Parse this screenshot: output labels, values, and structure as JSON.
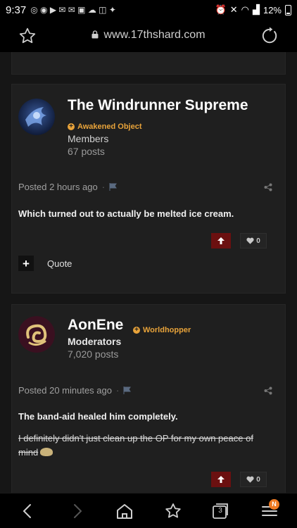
{
  "status": {
    "time": "9:37",
    "battery": "12%"
  },
  "browser": {
    "url": "www.17thshard.com"
  },
  "posts": [
    {
      "username": "The Windrunner Supreme",
      "badge": "Awakened Object",
      "group": "Members",
      "post_count": "67 posts",
      "posted": "Posted 2 hours ago",
      "body": "Which turned out to actually be melted ice cream.",
      "likes": "0",
      "quote_label": "Quote"
    },
    {
      "username": "AonEne",
      "badge": "Worldhopper",
      "group": "Moderators",
      "post_count": "7,020 posts",
      "posted": "Posted 20 minutes ago",
      "body": "The band-aid healed him completely.",
      "strike": "I definitely didn't just clean up the OP for my own peace of mind",
      "likes": "0"
    }
  ],
  "bottom_nav": {
    "notification_badge": "N",
    "tab_count": "3"
  },
  "colors": {
    "accent": "#e8a33a",
    "upvote": "#6b1010",
    "background": "#161616",
    "card": "#1f1f1f"
  }
}
